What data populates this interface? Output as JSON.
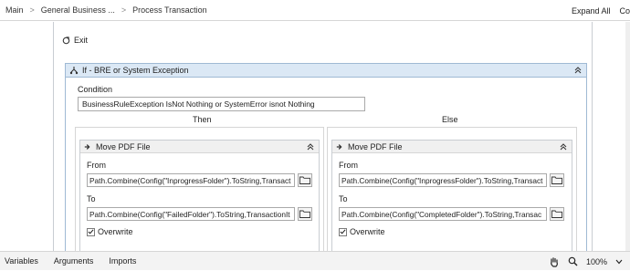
{
  "breadcrumb": [
    "Main",
    "General Business ...",
    "Process Transaction"
  ],
  "breadcrumb_separator": ">",
  "header_actions": {
    "expand_all": "Expand All",
    "collapse": "Co"
  },
  "exit_label": "Exit",
  "if_activity": {
    "title": "If - BRE or System Exception",
    "condition_label": "Condition",
    "condition_value": "BusinessRuleException IsNot Nothing or SystemError isnot Nothing",
    "then_label": "Then",
    "else_label": "Else"
  },
  "then_move": {
    "title": "Move PDF File",
    "from_label": "From",
    "from_value": "Path.Combine(Config(\"InprogressFolder\").ToString,Transact",
    "to_label": "To",
    "to_value": "Path.Combine(Config(\"FailedFolder\").ToString,TransactionIt",
    "overwrite_label": "Overwrite",
    "overwrite_checked": true
  },
  "else_move": {
    "title": "Move PDF File",
    "from_label": "From",
    "from_value": "Path.Combine(Config(\"InprogressFolder\").ToString,Transact",
    "to_label": "To",
    "to_value": "Path.Combine(Config(\"CompletedFolder\").ToString,Transac",
    "overwrite_label": "Overwrite",
    "overwrite_checked": true
  },
  "bottom_tabs": [
    "Variables",
    "Arguments",
    "Imports"
  ],
  "zoom": "100%",
  "icons": [
    "exit-icon",
    "if-icon",
    "collapse-icon",
    "move-arrow-icon",
    "folder-icon",
    "checkmark-icon",
    "hand-icon",
    "search-icon",
    "dropdown-icon"
  ],
  "colors": {
    "if_header": "#dbe8f5",
    "if_border": "#9fb9d4"
  }
}
